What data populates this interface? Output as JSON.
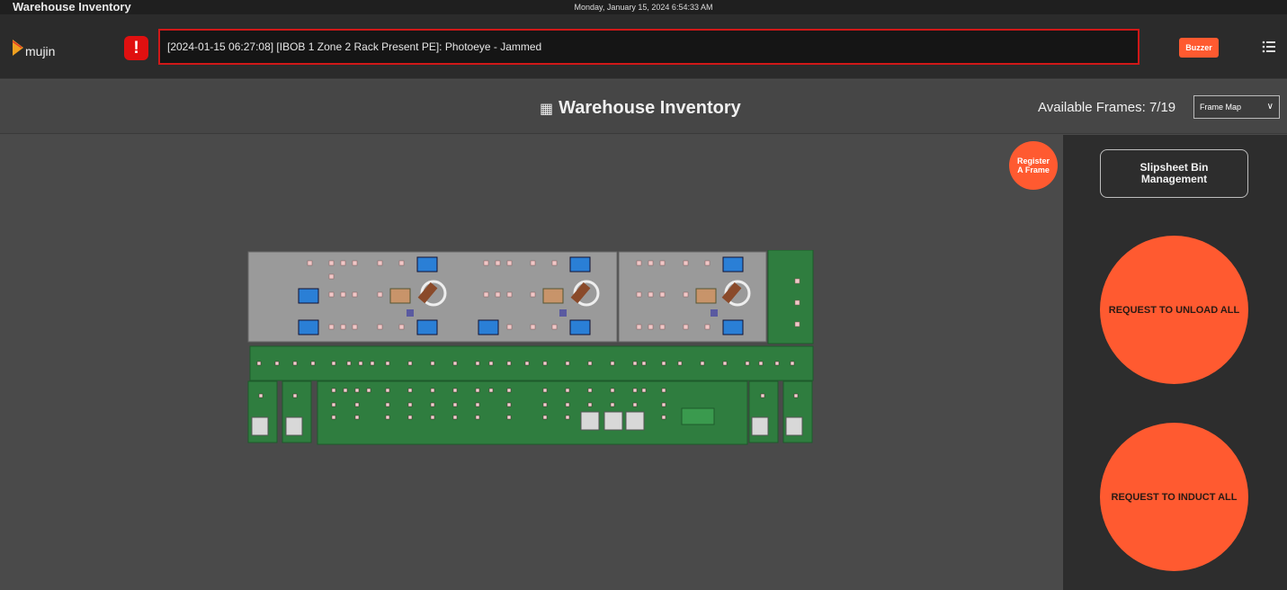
{
  "window": {
    "title": "Warehouse Inventory",
    "clock": "Monday, January 15, 2024 6:54:33 AM"
  },
  "header": {
    "logo_text": "mujin",
    "alarm_message": "[2024-01-15 06:27:08] [IBOB 1 Zone 2 Rack Present PE]: Photoeye - Jammed",
    "buzzer_label": "Buzzer",
    "colors": {
      "alarm": "#d01818",
      "accent": "#ff5a30"
    }
  },
  "title_row": {
    "title": "Warehouse Inventory",
    "title_icon": "boxes-icon",
    "available_frames": "Available Frames: 7/19",
    "view_select": "Frame Map"
  },
  "canvas": {
    "register_label_1": "Register",
    "register_label_2": "A Frame"
  },
  "side": {
    "slipsheet_line1": "Slipsheet Bin",
    "slipsheet_line2": "Management",
    "unload_all": "REQUEST TO UNLOAD ALL",
    "induct_all": "REQUEST TO INDUCT ALL"
  },
  "map_colors": {
    "rack": "#9a9a9a",
    "conveyor": "#2f7d3f",
    "frame_blue": "#2a7fd6",
    "frame_tan": "#c8946a",
    "frame_empty": "#d8d8d8"
  }
}
